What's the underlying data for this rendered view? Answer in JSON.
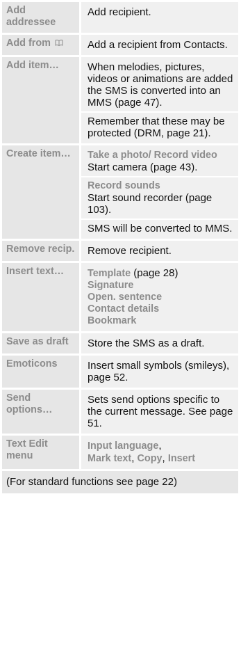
{
  "rows": [
    {
      "label": "Add addressee",
      "text": "Add recipient."
    },
    {
      "label": "Add from",
      "icon": "book-icon",
      "text": "Add a recipient from Contacts."
    },
    {
      "label": "Add item…",
      "p1": "When melodies, pictures, videos or animations are added the SMS is converted into an MMS (page 47).",
      "p2": "Remember that these may be protected (DRM, page 21)."
    },
    {
      "label": "Create item…",
      "sub1_title": "Take a photo/ Record video",
      "sub1_text": "Start camera (page 43).",
      "sub2_title": "Record sounds",
      "sub2_text": "Start sound recorder (page 103).",
      "p3": "SMS will be converted to MMS."
    },
    {
      "label": "Remove recip.",
      "text": "Remove recipient."
    },
    {
      "label": "Insert text…",
      "item1": "Template",
      "item1_ref": " (page 28)",
      "item2": "Signature",
      "item3": "Open. sentence",
      "item4": "Contact details",
      "item5": "Bookmark"
    },
    {
      "label": "Save as draft",
      "text": "Store the SMS as a draft."
    },
    {
      "label": "Emoticons",
      "text": "Insert small symbols (smileys), page 52."
    },
    {
      "label": "Send options…",
      "text": "Sets send options specific to the current message. See page 51."
    },
    {
      "label": "Text Edit menu",
      "opt1": "Input language",
      "comma1": ",",
      "opt2": "Mark text",
      "comma2": ", ",
      "opt3": "Copy",
      "comma3": ", ",
      "opt4": "Insert"
    }
  ],
  "footer": "(For standard functions see page 22)"
}
